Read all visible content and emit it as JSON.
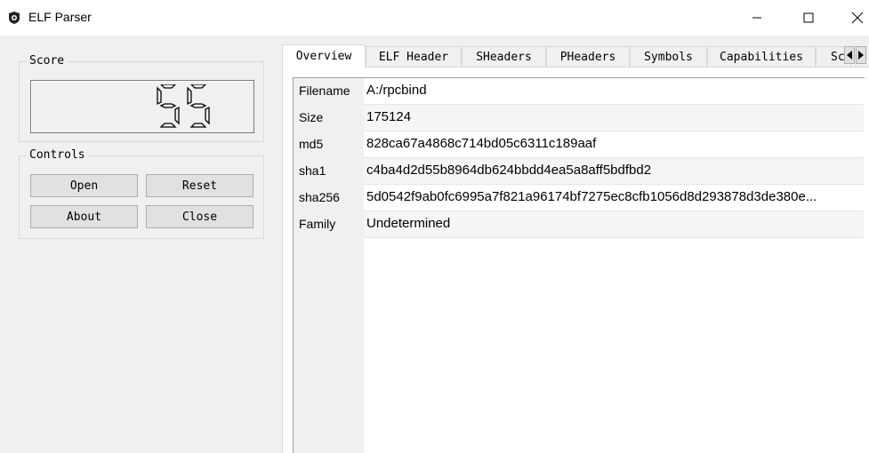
{
  "window": {
    "title": "ELF Parser",
    "minimize_glyph": "—",
    "maximize_glyph": "☐",
    "close_glyph": "✕"
  },
  "score": {
    "label": "Score",
    "value": "55"
  },
  "controls": {
    "label": "Controls",
    "open": "Open",
    "reset": "Reset",
    "about": "About",
    "close": "Close"
  },
  "tabs": [
    {
      "label": "Overview",
      "active": true
    },
    {
      "label": "ELF Header"
    },
    {
      "label": "SHeaders"
    },
    {
      "label": "PHeaders"
    },
    {
      "label": "Symbols"
    },
    {
      "label": "Capabilities"
    },
    {
      "label": "Sc"
    }
  ],
  "overview": {
    "rows": [
      {
        "key": "Filename",
        "value": "A:/rpcbind"
      },
      {
        "key": "Size",
        "value": "175124"
      },
      {
        "key": "md5",
        "value": "828ca67a4868c714bd05c6311c189aaf"
      },
      {
        "key": "sha1",
        "value": "c4ba4d2d55b8964db624bbdd4ea5a8aff5bdfbd2"
      },
      {
        "key": "sha256",
        "value": "5d0542f9ab0fc6995a7f821a96174bf7275ec8cfb1056d8d293878d3de380e..."
      },
      {
        "key": "Family",
        "value": "Undetermined"
      }
    ]
  },
  "colors": {
    "window_bg": "#f0f0f0",
    "titlebar_bg": "#ffffff",
    "button_bg": "#e1e1e1",
    "border": "#adadad"
  },
  "icons": {
    "app": "app-logo-icon",
    "tab_left": "arrow-left-icon",
    "tab_right": "arrow-right-icon"
  }
}
